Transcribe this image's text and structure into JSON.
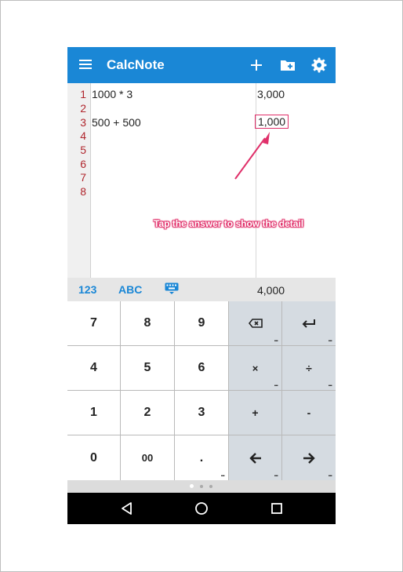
{
  "app": {
    "title": "CalcNote",
    "icons": [
      "menu-icon",
      "add-icon",
      "new-folder-icon",
      "settings-icon"
    ],
    "accent_color": "#1a87d6"
  },
  "editor": {
    "line_numbers": [
      "1",
      "2",
      "3",
      "4",
      "5",
      "6",
      "7",
      "8"
    ],
    "lines": [
      {
        "expr": "1000 * 3",
        "answer": "3,000"
      },
      {
        "expr": "",
        "answer": ""
      },
      {
        "expr": "500 + 500",
        "answer": "1,000"
      }
    ],
    "highlight_color": "#e0306a"
  },
  "callout": {
    "text": "Tap the answer to show the detail"
  },
  "keyboard_bar": {
    "tab_numeric": "123",
    "tab_alpha": "ABC",
    "total": "4,000"
  },
  "keys": {
    "row1": [
      "7",
      "8",
      "9",
      "⌫",
      "↵"
    ],
    "row2": [
      "4",
      "5",
      "6",
      "×",
      "÷"
    ],
    "row3": [
      "1",
      "2",
      "3",
      "+",
      "-"
    ],
    "row4": [
      "0",
      "00",
      ".",
      "←",
      "→"
    ],
    "more": "..."
  },
  "navbar": {
    "icons": [
      "back-icon",
      "home-icon",
      "recents-icon"
    ]
  }
}
